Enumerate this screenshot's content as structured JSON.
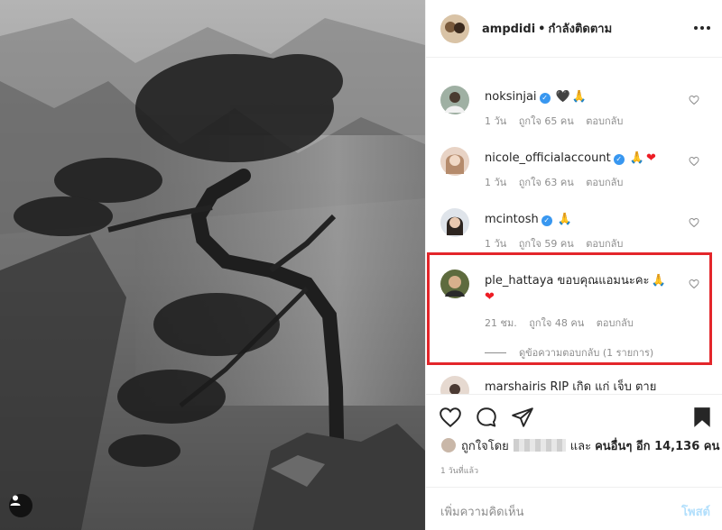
{
  "post": {
    "author": "ampdidi",
    "separator": "•",
    "follow_status": "กำลังติดตาม",
    "more_icon": "more-horizontal-icon"
  },
  "comments": [
    {
      "username": "noksinjai",
      "verified": true,
      "text": "",
      "emojis": [
        "🖤",
        "🙏"
      ],
      "time": "1 วัน",
      "likes": "ถูกใจ 65 คน",
      "reply": "ตอบกลับ"
    },
    {
      "username": "nicole_officialaccount",
      "verified": true,
      "text": "",
      "emojis": [
        "🙏",
        "❤"
      ],
      "time": "1 วัน",
      "likes": "ถูกใจ 63 คน",
      "reply": "ตอบกลับ"
    },
    {
      "username": "mcintosh",
      "verified": true,
      "text": "",
      "emojis": [
        "🙏"
      ],
      "time": "1 วัน",
      "likes": "ถูกใจ 59 คน",
      "reply": "ตอบกลับ"
    },
    {
      "username": "ple_hattaya",
      "verified": false,
      "text": "ขอบคุณแอมนะคะ",
      "emojis": [
        "🙏",
        "❤"
      ],
      "time": "21 ชม.",
      "likes": "ถูกใจ 48 คน",
      "reply": "ตอบกลับ",
      "view_replies": "ดูข้อความตอบกลับ (1 รายการ)"
    },
    {
      "username": "marshairis",
      "verified": false,
      "text": "RIP เกิด แก่ เจ็บ ตาย"
    }
  ],
  "actions": {
    "like_icon": "heart-outline-icon",
    "comment_icon": "comment-bubble-icon",
    "share_icon": "paper-plane-icon",
    "save_icon": "bookmark-filled-icon"
  },
  "likes": {
    "prefix": "ถูกใจโดย",
    "middle": "และ",
    "others": "คนอื่นๆ อีก 14,136 คน"
  },
  "time_ago": "1 วันที่แล้ว",
  "add_comment": {
    "placeholder": "เพิ่มความคิดเห็น",
    "post_label": "โพสต์"
  },
  "colors": {
    "highlight_border": "#e3262b",
    "verified_badge": "#3897f0",
    "post_button_disabled": "#b2dffc",
    "meta_text": "#8e8e8e"
  }
}
